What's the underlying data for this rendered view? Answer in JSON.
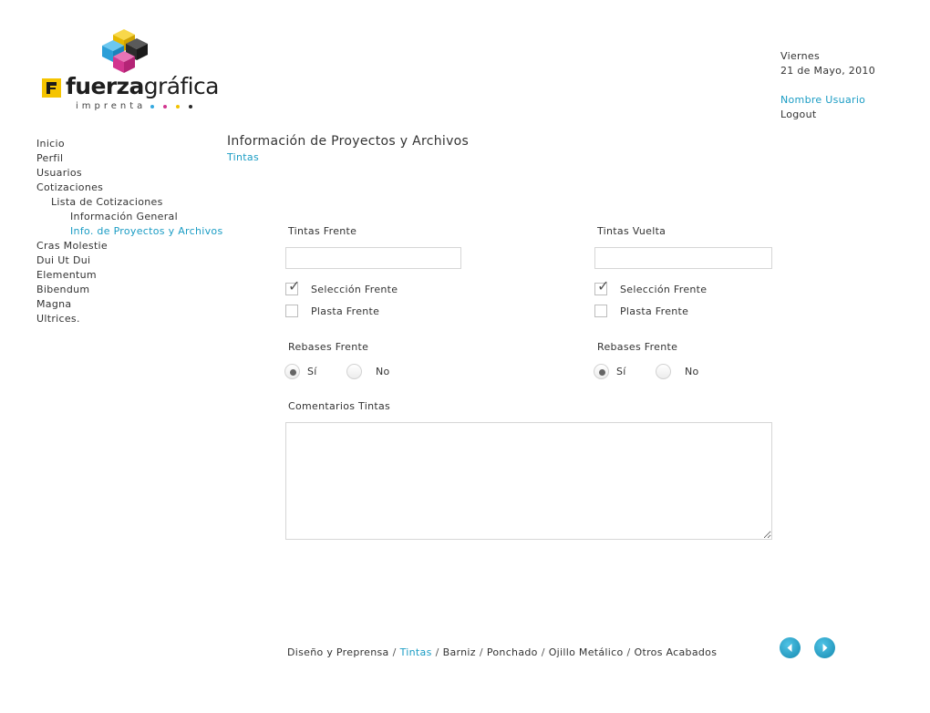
{
  "brand": {
    "name_bold": "fuerza",
    "name_regular": "gráfica",
    "tagline": "imprenta"
  },
  "header": {
    "day": "Viernes",
    "date": "21 de Mayo, 2010",
    "user_name": "Nombre Usuario",
    "logout": "Logout"
  },
  "sidebar": {
    "items": [
      {
        "label": "Inicio"
      },
      {
        "label": "Perfil"
      },
      {
        "label": "Usuarios"
      },
      {
        "label": "Cotizaciones"
      },
      {
        "label": "Lista de Cotizaciones"
      },
      {
        "label": "Información General"
      },
      {
        "label": "Info. de Proyectos y Archivos"
      },
      {
        "label": "Cras Molestie"
      },
      {
        "label": "Dui Ut Dui"
      },
      {
        "label": "Elementum"
      },
      {
        "label": "Bibendum"
      },
      {
        "label": "Magna"
      },
      {
        "label": "Ultrices."
      }
    ]
  },
  "page": {
    "title": "Información de Proyectos y Archivos",
    "subtitle": "Tintas"
  },
  "form": {
    "front": {
      "inks_label": "Tintas Frente",
      "inks_value": "",
      "selection_label": "Selección Frente",
      "selection_checked": true,
      "plate_label": "Plasta Frente",
      "plate_checked": false,
      "bleed_label": "Rebases Frente",
      "yes_label": "Sí",
      "no_label": "No",
      "bleed_value": "Sí"
    },
    "back": {
      "inks_label": "Tintas Vuelta",
      "inks_value": "",
      "selection_label": "Selección Frente",
      "selection_checked": true,
      "plate_label": "Plasta Frente",
      "plate_checked": false,
      "bleed_label": "Rebases Frente",
      "yes_label": "Sí",
      "no_label": "No",
      "bleed_value": "Sí"
    },
    "comments_label": "Comentarios Tintas",
    "comments_value": ""
  },
  "steps": {
    "items": [
      {
        "label": "Diseño y Preprensa"
      },
      {
        "label": "Tintas"
      },
      {
        "label": "Barniz"
      },
      {
        "label": "Ponchado"
      },
      {
        "label": "Ojillo Metálico"
      },
      {
        "label": "Otros Acabados"
      }
    ],
    "separator": "/"
  },
  "colors": {
    "accent": "#1a9cc4",
    "text": "#333333",
    "brand_yellow": "#f5c400",
    "cube_cyan": "#35a9e0",
    "cube_magenta": "#d2368f",
    "cube_yellow": "#f2c200",
    "cube_black": "#2a2a2a"
  }
}
